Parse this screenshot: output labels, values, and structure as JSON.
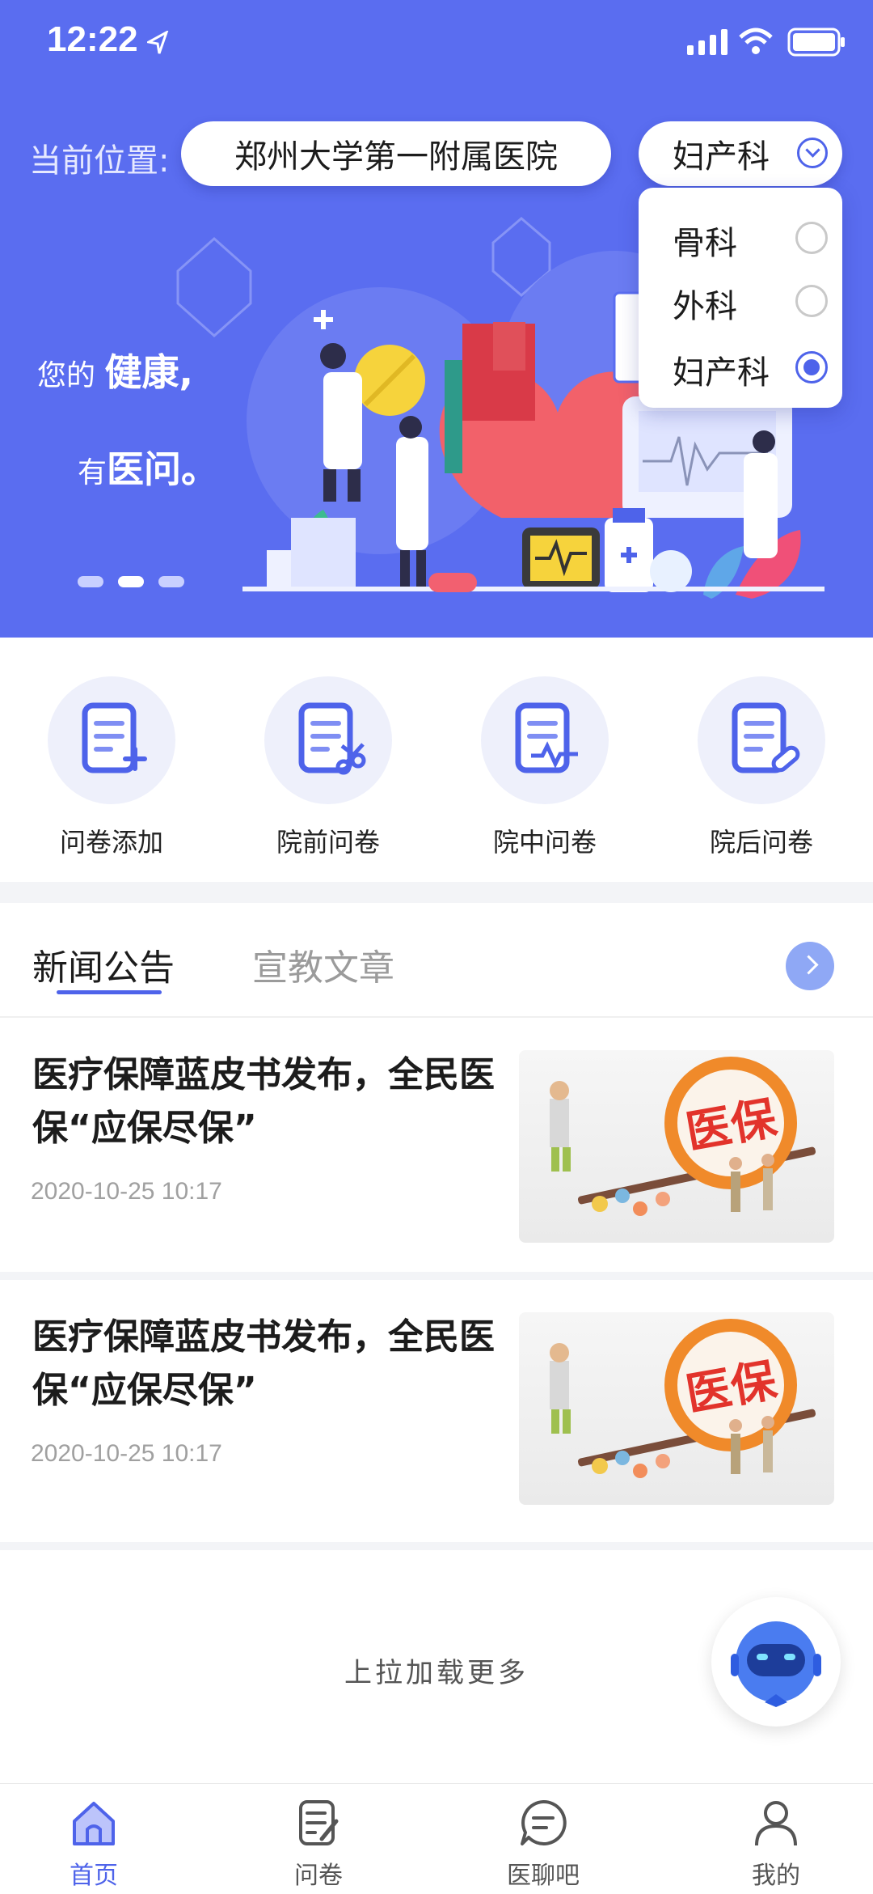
{
  "status_bar": {
    "time": "12:22"
  },
  "location": {
    "label": "当前位置:",
    "hospital": "郑州大学第一附属医院",
    "department": "妇产科"
  },
  "department_dropdown": {
    "options": [
      {
        "label": "骨科",
        "selected": false
      },
      {
        "label": "外科",
        "selected": false
      },
      {
        "label": "妇产科",
        "selected": true
      }
    ]
  },
  "banner": {
    "line1_prefix": "您的",
    "line1_emphasis": "健康,",
    "line2_prefix": "有",
    "line2_emphasis": "医问。",
    "carousel_active_index": 1,
    "carousel_count": 3
  },
  "shortcuts": [
    {
      "label": "问卷添加",
      "icon": "doc-add-icon"
    },
    {
      "label": "院前问卷",
      "icon": "doc-scissors-icon"
    },
    {
      "label": "院中问卷",
      "icon": "doc-pulse-icon"
    },
    {
      "label": "院后问卷",
      "icon": "doc-pill-icon"
    }
  ],
  "news_tabs": {
    "active": "新闻公告",
    "inactive": "宣教文章"
  },
  "articles": [
    {
      "title": "医疗保障蓝皮书发布，全民医保“应保尽保”",
      "date": "2020-10-25 10:17",
      "image_text": "医保"
    },
    {
      "title": "医疗保障蓝皮书发布，全民医保“应保尽保”",
      "date": "2020-10-25 10:17",
      "image_text": "医保"
    }
  ],
  "load_more": "上拉加载更多",
  "tabbar": [
    {
      "label": "首页",
      "active": true
    },
    {
      "label": "问卷",
      "active": false
    },
    {
      "label": "医聊吧",
      "active": false
    },
    {
      "label": "我的",
      "active": false
    }
  ],
  "colors": {
    "primary": "#5a6df0",
    "accent": "#4e63ea",
    "inactive": "#555555"
  }
}
